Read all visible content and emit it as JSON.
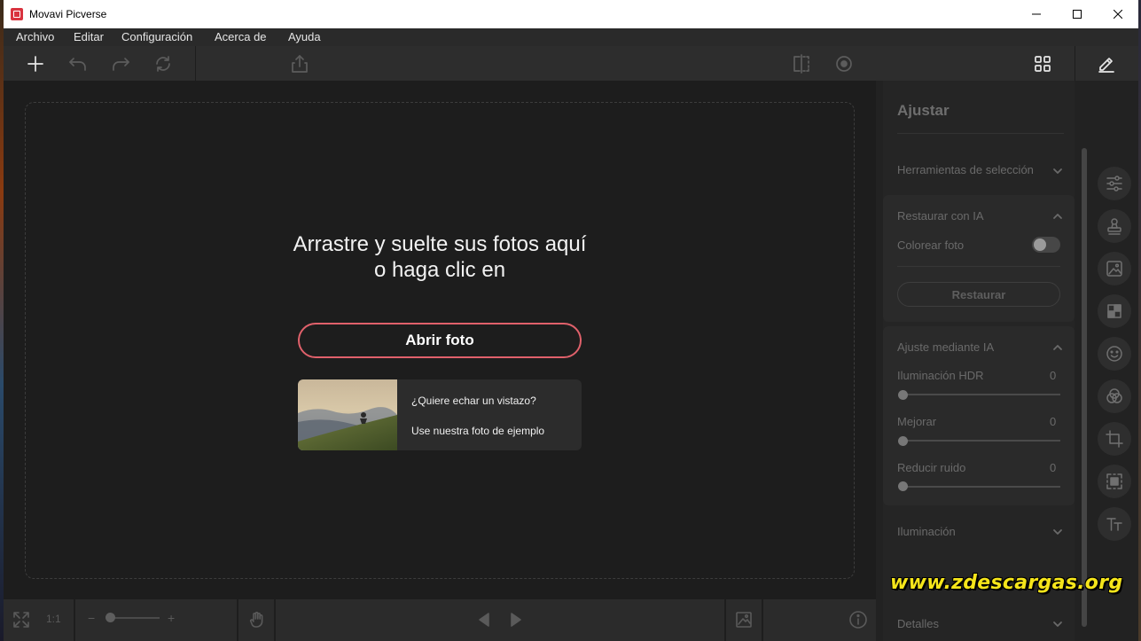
{
  "window": {
    "title": "Movavi Picverse"
  },
  "menu": {
    "items": [
      "Archivo",
      "Editar",
      "Configuración",
      "Acerca de",
      "Ayuda"
    ]
  },
  "toolbar": {
    "icons": [
      "plus-icon",
      "undo-icon",
      "redo-icon",
      "refresh-icon",
      "share-icon",
      "compare-icon",
      "preview-eye-icon",
      "grid-view-icon",
      "edit-pencil-icon"
    ]
  },
  "canvas": {
    "drop_text_line1": "Arrastre y suelte sus fotos aquí",
    "drop_text_line2": "o haga clic en",
    "open_button_label": "Abrir foto",
    "sample_question": "¿Quiere echar un vistazo?",
    "sample_subtitle": "Use nuestra foto de ejemplo"
  },
  "bottombar": {
    "zoom_label": "1:1",
    "zoom_minus": "−",
    "zoom_plus": "+",
    "zoom_level": 0.0
  },
  "panel": {
    "title": "Ajustar",
    "selection_tools_label": "Herramientas de selección",
    "restore_ai": {
      "header": "Restaurar con IA",
      "colorize_label": "Colorear foto",
      "colorize_on": false,
      "restore_button": "Restaurar"
    },
    "ai_adjust": {
      "header": "Ajuste mediante IA",
      "sliders": [
        {
          "label": "Iluminación HDR",
          "value": "0"
        },
        {
          "label": "Mejorar",
          "value": "0"
        },
        {
          "label": "Reducir ruido",
          "value": "0"
        }
      ]
    },
    "lighting_label": "Iluminación",
    "details_label": "Detalles",
    "rail_icons": [
      "adjust-sliders-icon",
      "stamp-icon",
      "image-icon",
      "checker-icon",
      "smiley-icon",
      "color-circles-icon",
      "crop-icon",
      "selection-icon",
      "text-icon"
    ]
  },
  "watermark": {
    "text": "www.zdescargas.org"
  },
  "colors": {
    "accent": "#e0616b",
    "background": "#1d1d1d",
    "watermark": "#f5e51a"
  }
}
